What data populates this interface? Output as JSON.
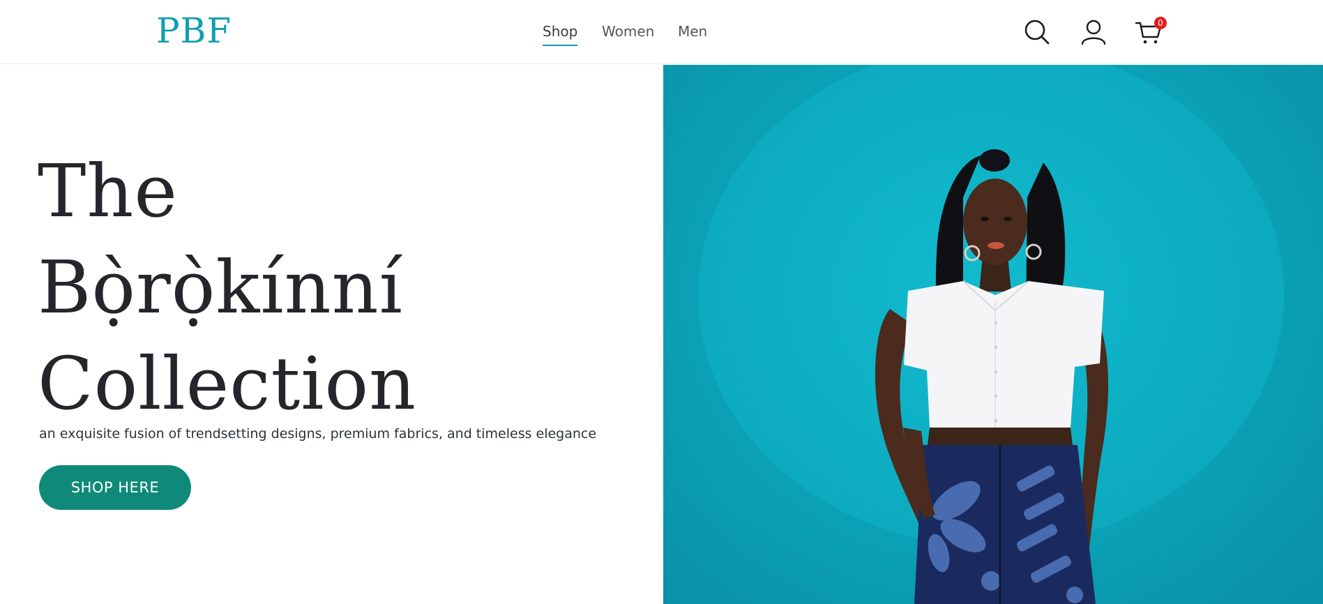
{
  "header": {
    "logo_text": "PBF",
    "nav": [
      {
        "label": "Shop",
        "active": true
      },
      {
        "label": "Women",
        "active": false
      },
      {
        "label": "Men",
        "active": false
      }
    ],
    "icons": [
      "search-icon",
      "user-icon",
      "cart-icon"
    ],
    "cart_count": "0"
  },
  "hero": {
    "title_line1": "The",
    "title_line2": "Bọ̀rọ̀kínní",
    "title_line3": "Collection",
    "subtitle": "an exquisite fusion of trendsetting designs, premium fabrics, and timeless elegance",
    "cta_label": "SHOP HERE"
  },
  "colors": {
    "brand": "#0f9fb0",
    "cta": "#0f8a78",
    "hero_background": "#0aa6bb",
    "badge": "#e11b1b"
  }
}
